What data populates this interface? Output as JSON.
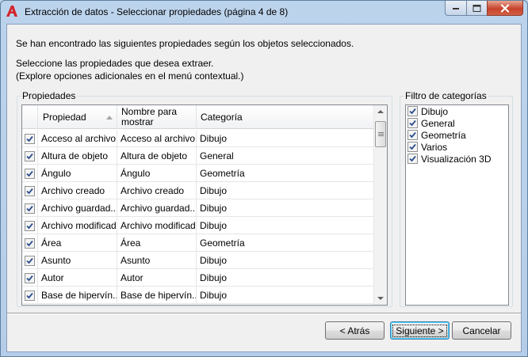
{
  "window": {
    "title": "Extracción de datos - Seleccionar propiedades (página 4 de 8)"
  },
  "intro": {
    "line1": "Se han encontrado las siguientes propiedades según los objetos seleccionados.",
    "line2": "Seleccione las propiedades que desea extraer.",
    "line3": "(Explore opciones adicionales en el menú contextual.)"
  },
  "properties": {
    "group_label": "Propiedades",
    "columns": [
      "Propiedad",
      "Nombre para\nmostrar",
      "Categoría"
    ],
    "sort_column": "Propiedad",
    "rows": [
      {
        "checked": true,
        "property": "Acceso al archivo",
        "display": "Acceso al archivo",
        "category": "Dibujo"
      },
      {
        "checked": true,
        "property": "Altura de objeto",
        "display": "Altura de objeto",
        "category": "General"
      },
      {
        "checked": true,
        "property": "Ángulo",
        "display": "Ángulo",
        "category": "Geometría"
      },
      {
        "checked": true,
        "property": "Archivo creado",
        "display": "Archivo creado",
        "category": "Dibujo"
      },
      {
        "checked": true,
        "property": "Archivo guardad...",
        "display": "Archivo guardad...",
        "category": "Dibujo"
      },
      {
        "checked": true,
        "property": "Archivo modificado",
        "display": "Archivo modificado",
        "category": "Dibujo"
      },
      {
        "checked": true,
        "property": "Área",
        "display": "Área",
        "category": "Geometría"
      },
      {
        "checked": true,
        "property": "Asunto",
        "display": "Asunto",
        "category": "Dibujo"
      },
      {
        "checked": true,
        "property": "Autor",
        "display": "Autor",
        "category": "Dibujo"
      },
      {
        "checked": true,
        "property": "Base de hipervín...",
        "display": "Base de hipervín...",
        "category": "Dibujo"
      }
    ]
  },
  "filter": {
    "group_label": "Filtro de categorías",
    "items": [
      {
        "checked": true,
        "label": "Dibujo"
      },
      {
        "checked": true,
        "label": "General"
      },
      {
        "checked": true,
        "label": "Geometría"
      },
      {
        "checked": true,
        "label": "Varios"
      },
      {
        "checked": true,
        "label": "Visualización 3D"
      }
    ]
  },
  "buttons": {
    "back": "< Atrás",
    "next": "Siguiente >",
    "cancel": "Cancelar"
  },
  "icons": {
    "app": "autocad-a-icon",
    "minimize": "minimize-icon",
    "maximize": "maximize-icon",
    "close": "close-icon",
    "check": "checkmark-icon",
    "sort": "sort-ascending-icon"
  },
  "colors": {
    "app_icon": "#d3242b",
    "checkmark": "#2c4f8c",
    "default_button_border": "#3c7fb1"
  }
}
